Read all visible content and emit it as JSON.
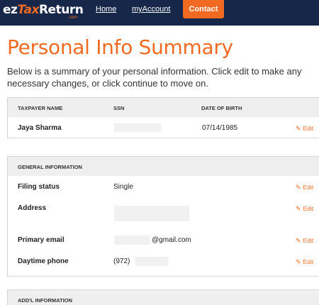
{
  "nav": {
    "logo_ez": "ez",
    "logo_tax": "Tax",
    "logo_return": "Return",
    "logo_com": ".com",
    "home": "Home",
    "account": "myAccount",
    "contact": "Contact"
  },
  "page": {
    "title": "Personal Info Summary",
    "intro": "Below is a summary of your personal information. Click edit to make any necessary changes, or click continue to move on."
  },
  "taxpayer": {
    "headers": {
      "name": "TAXPAYER NAME",
      "ssn": "SSN",
      "dob": "DATE OF BIRTH"
    },
    "name": "Jaya Sharma",
    "dob": "07/14/1985",
    "edit": "Edit"
  },
  "general": {
    "header": "GENERAL INFORMATION",
    "filing_label": "Filing status",
    "filing_value": "Single",
    "address_label": "Address",
    "email_label": "Primary email",
    "email_value": "@gmail.com",
    "phone_label": "Daytime phone",
    "phone_value": "(972)",
    "edit": "Edit"
  },
  "addl": {
    "header": "ADD'L INFORMATION"
  },
  "colors": {
    "accent": "#f26a22",
    "navbar": "#16274a",
    "header_bg": "#efefef"
  }
}
